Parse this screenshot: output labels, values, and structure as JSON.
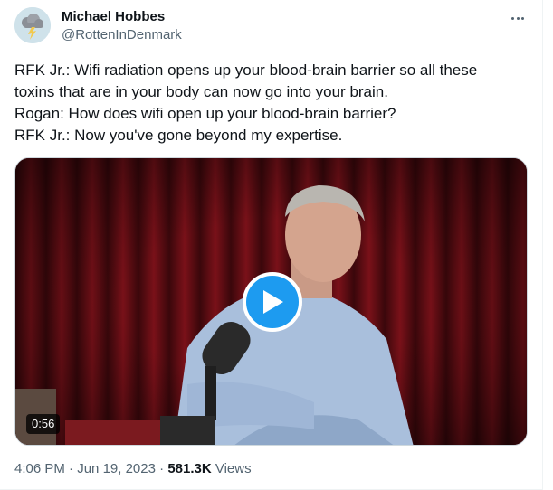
{
  "author": {
    "name": "Michael Hobbes",
    "handle": "@RottenInDenmark",
    "avatar_icon": "storm-cloud-icon"
  },
  "tweet": {
    "lines": [
      "RFK Jr.: Wifi radiation opens up your blood-brain barrier so all these",
      "toxins that are in your body can now go into your brain.",
      "Rogan: How does wifi open up your blood-brain barrier?",
      "RFK Jr.: Now you've gone beyond my expertise."
    ]
  },
  "media": {
    "type": "video",
    "duration": "0:56",
    "play_icon": "play-icon"
  },
  "meta": {
    "time": "4:06 PM",
    "separator": "·",
    "date": "Jun 19, 2023",
    "views_count": "581.3K",
    "views_label": "Views"
  },
  "colors": {
    "accent": "#1d9bf0",
    "text_primary": "#0f1419",
    "text_secondary": "#536471"
  }
}
